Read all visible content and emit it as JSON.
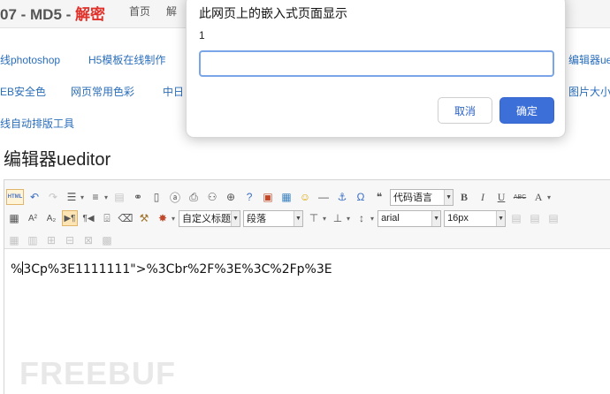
{
  "header": {
    "title_prefix": "07 - MD5 - ",
    "title_highlight": "解密",
    "nav": [
      "首页",
      "解"
    ]
  },
  "link_rows": {
    "row1": [
      "线photoshop",
      "H5模板在线制作",
      "编辑器ue"
    ],
    "row2": [
      "EB安全色",
      "网页常用色彩",
      "中日",
      "图片大小"
    ],
    "row3": [
      "线自动排版工具"
    ]
  },
  "section_title": "编辑器ueditor",
  "toolbar": {
    "html_label": "HTML",
    "code_lang": "代码语言",
    "custom_title": "自定义标题",
    "paragraph": "段落",
    "font_family": "arial",
    "font_size": "16px",
    "bold": "B",
    "italic": "I",
    "underline": "U",
    "strike": "ABC",
    "font_color": "A"
  },
  "editor_content": {
    "before_cursor": "%",
    "after_cursor": "3Cp%3E1111111\">%3Cbr%2F%3E%3C%2Fp%3E"
  },
  "watermark": "FREEBUF",
  "dialog": {
    "title": "此网页上的嵌入式页面显示",
    "message": "1",
    "input_value": "",
    "cancel_label": "取消",
    "ok_label": "确定"
  }
}
